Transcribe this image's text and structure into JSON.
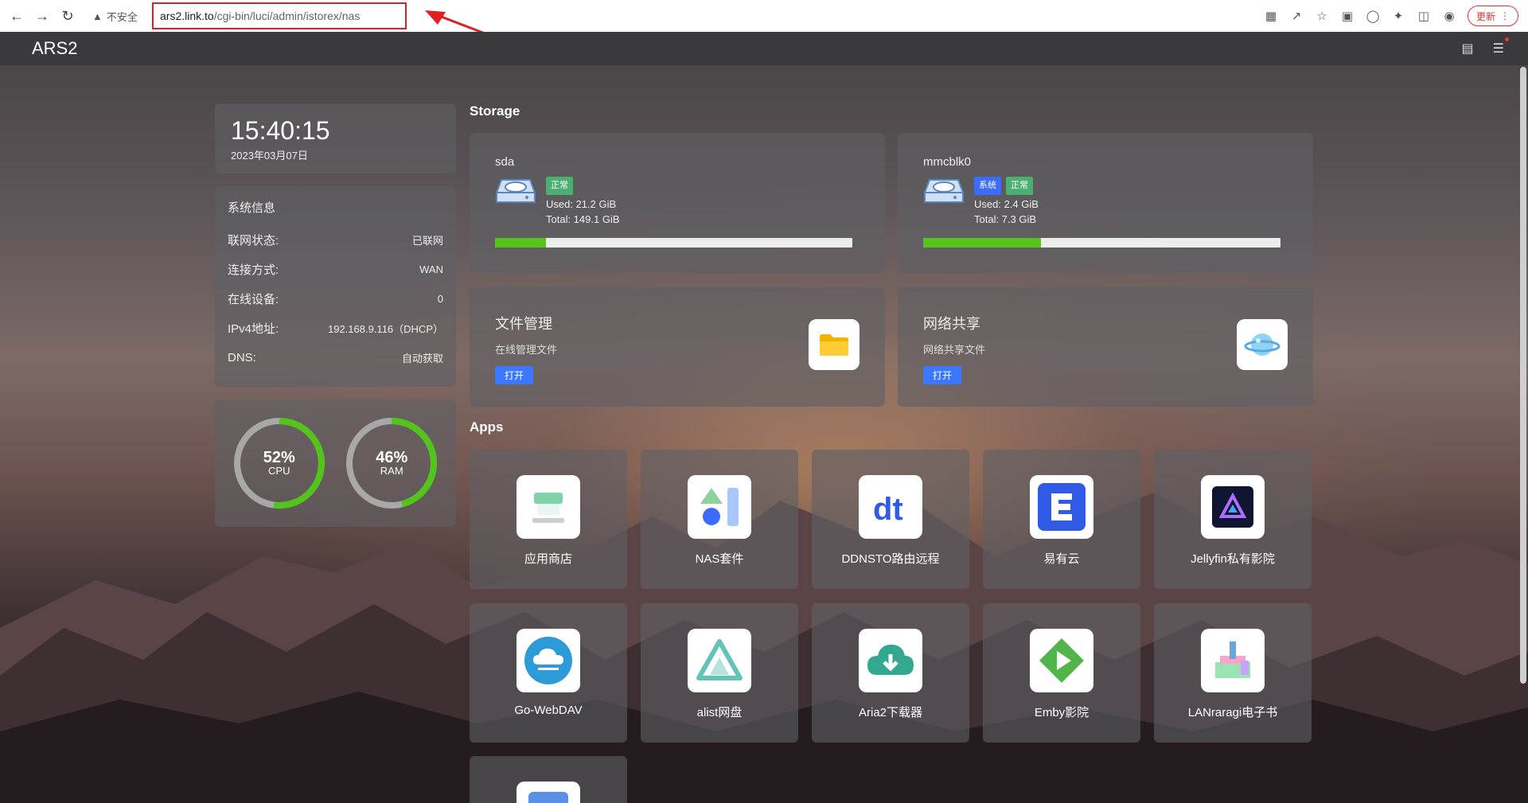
{
  "browser": {
    "security_label": "不安全",
    "url_host": "ars2.link.to",
    "url_path": "/cgi-bin/luci/admin/istorex/nas",
    "update_label": "更新"
  },
  "header": {
    "brand": "ARS2"
  },
  "clock": {
    "time": "15:40:15",
    "date": "2023年03月07日"
  },
  "sysinfo": {
    "title": "系统信息",
    "rows": [
      {
        "label": "联网状态:",
        "value": "已联网"
      },
      {
        "label": "连接方式:",
        "value": "WAN"
      },
      {
        "label": "在线设备:",
        "value": "0"
      },
      {
        "label": "IPv4地址:",
        "value": "192.168.9.116（DHCP）"
      },
      {
        "label": "DNS:",
        "value": "自动获取"
      }
    ]
  },
  "usage": {
    "cpu": {
      "percent": 52,
      "label": "52%",
      "name": "CPU"
    },
    "ram": {
      "percent": 46,
      "label": "46%",
      "name": "RAM"
    },
    "ring_color": "#52c41a",
    "track_color": "#a8a8a8"
  },
  "storage": {
    "title": "Storage",
    "disks": [
      {
        "name": "sda",
        "badges": [
          "正常"
        ],
        "used": "Used: 21.2 GiB",
        "total": "Total: 149.1 GiB",
        "fraction": 0.142
      },
      {
        "name": "mmcblk0",
        "badges": [
          "系统",
          "正常"
        ],
        "used": "Used: 2.4 GiB",
        "total": "Total: 7.3 GiB",
        "fraction": 0.33
      }
    ]
  },
  "features": [
    {
      "title": "文件管理",
      "subtitle": "在线管理文件",
      "button": "打开",
      "icon": "folder-icon"
    },
    {
      "title": "网络共享",
      "subtitle": "网络共享文件",
      "button": "打开",
      "icon": "planet-icon"
    }
  ],
  "apps": {
    "title": "Apps",
    "items": [
      {
        "name": "应用商店",
        "icon": "store-icon"
      },
      {
        "name": "NAS套件",
        "icon": "nas-suite-icon"
      },
      {
        "name": "DDNSTO路由远程",
        "icon": "ddnsto-icon"
      },
      {
        "name": "易有云",
        "icon": "linkease-icon"
      },
      {
        "name": "Jellyfin私有影院",
        "icon": "jellyfin-icon"
      },
      {
        "name": "Go-WebDAV",
        "icon": "webdav-cloud-icon"
      },
      {
        "name": "alist网盘",
        "icon": "alist-icon"
      },
      {
        "name": "Aria2下载器",
        "icon": "aria2-cloud-download-icon"
      },
      {
        "name": "Emby影院",
        "icon": "emby-icon"
      },
      {
        "name": "LANraragi电子书",
        "icon": "lanraragi-icon"
      },
      {
        "name": "",
        "icon": "app-icon"
      }
    ]
  }
}
